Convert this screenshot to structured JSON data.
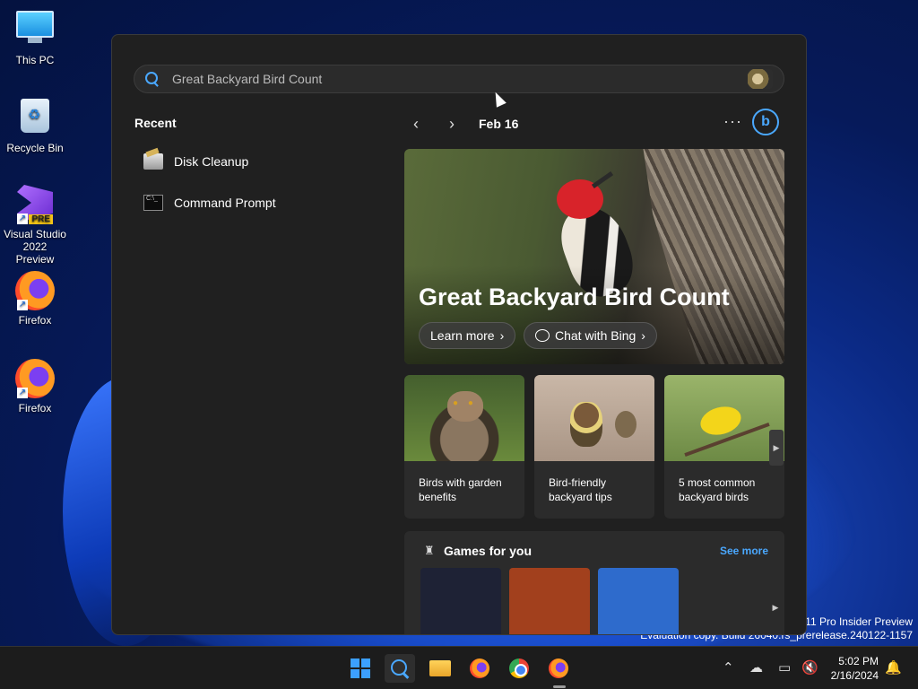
{
  "desktop": {
    "icons": [
      {
        "label": "This PC"
      },
      {
        "label": "Recycle Bin"
      },
      {
        "label": "Visual Studio 2022 Preview",
        "badge": "PRE"
      },
      {
        "label": "Firefox"
      },
      {
        "label": "Firefox"
      }
    ],
    "watermark": {
      "line1": "s 11 Pro Insider Preview",
      "line2": "Evaluation copy. Build 26040.rs_prerelease.240122-1157"
    }
  },
  "search": {
    "value": "Great Backyard Bird Count",
    "placeholder": "Great Backyard Bird Count",
    "recent_title": "Recent",
    "recent_items": [
      {
        "label": "Disk Cleanup",
        "icon": "disk-cleanup-icon"
      },
      {
        "label": "Command Prompt",
        "icon": "command-prompt-icon"
      }
    ],
    "date": "Feb 16",
    "more_label": "···",
    "bing_label": "b"
  },
  "hero": {
    "title": "Great Backyard Bird Count",
    "learn_more": "Learn more",
    "chat_with_bing": "Chat with Bing"
  },
  "cards": [
    {
      "title": "Birds with garden benefits"
    },
    {
      "title": "Bird-friendly backyard tips"
    },
    {
      "title": "5 most common backyard birds"
    }
  ],
  "games": {
    "title": "Games for you",
    "see_more": "See more",
    "tile_colors": [
      "#1e2235",
      "#a2401d",
      "#2e6bcc"
    ]
  },
  "taskbar": {
    "clock_time": "5:02 PM",
    "clock_date": "2/16/2024"
  },
  "colors": {
    "accent": "#4aa8ff",
    "panel_bg": "#202020",
    "card_bg": "#2b2b2b"
  }
}
